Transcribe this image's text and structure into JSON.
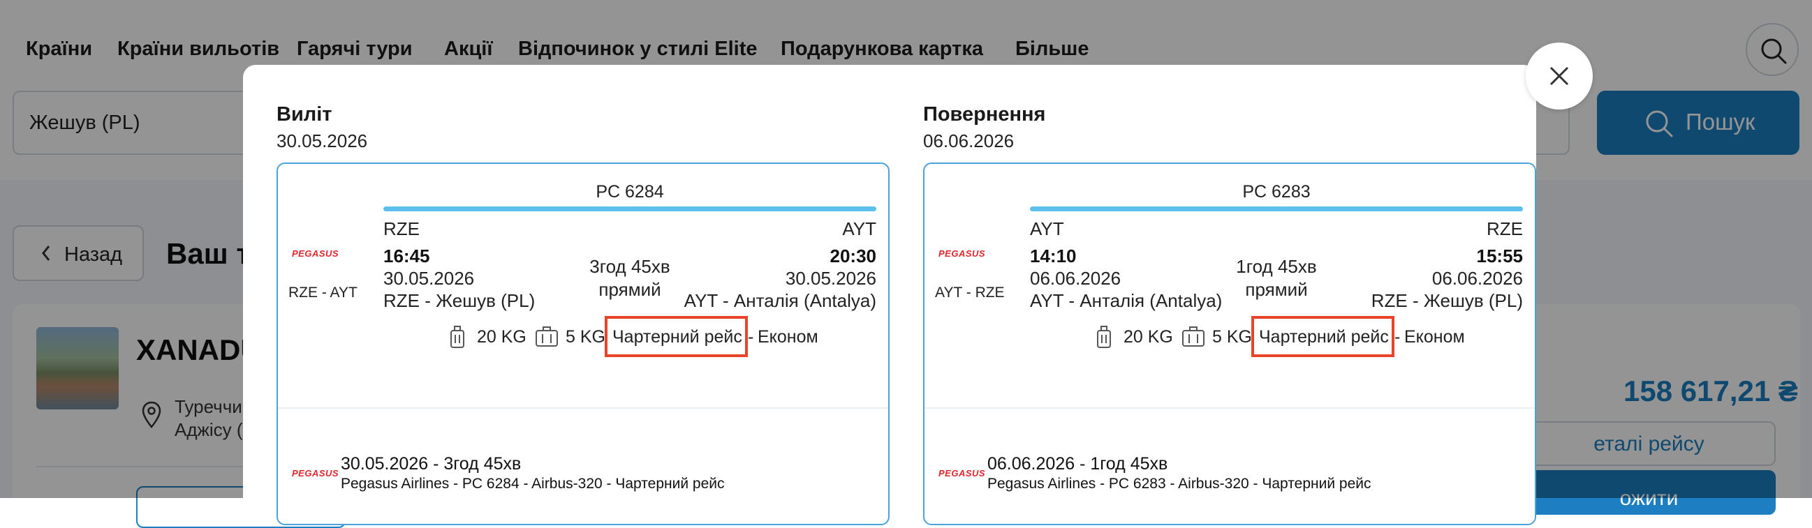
{
  "nav": {
    "items": [
      "Країни",
      "Країни вильотів",
      "Гарячі тури",
      "Акції",
      "Відпочинок у стилі Elite",
      "Подарункова картка",
      "Більше"
    ]
  },
  "search": {
    "origin_value": "Жешув (PL)",
    "button_label": "Пошук"
  },
  "page": {
    "back_label": "Назад",
    "title": "Ваш т",
    "hotel_name": "XANADU",
    "location_line1": "Туреччин",
    "location_line2": "Аджісу (А",
    "price": "158 617,21 ₴",
    "details_label": "еталі рейсу",
    "book_label": "ожити"
  },
  "colors": {
    "accent": "#1d7fc2",
    "route_bar": "#5bc0eb",
    "highlight": "#e8442a",
    "airline": "#e3262d"
  },
  "modal": {
    "departure": {
      "heading": "Виліт",
      "date": "30.05.2026",
      "airline_logo": "PEGASUS",
      "route_short": "RZE - AYT",
      "flight_number": "PC 6284",
      "from_code": "RZE",
      "to_code": "AYT",
      "dep_time": "16:45",
      "arr_time": "20:30",
      "dep_date": "30.05.2026",
      "arr_date": "30.05.2026",
      "duration": "3год 45хв",
      "stops": "прямий",
      "from_city": "RZE - Жешув (PL)",
      "to_city": "AYT - Анталія (Antalya)",
      "baggage": "20 KG",
      "hand_luggage": "5 KG",
      "flight_type": "Чартерний рейс",
      "sep": "-",
      "class": "Економ",
      "segment_date": "30.05.2026 - 3год 45хв",
      "segment_info": "Pegasus Airlines - PC 6284 - Airbus-320 - Чартерний рейс"
    },
    "return": {
      "heading": "Повернення",
      "date": "06.06.2026",
      "airline_logo": "PEGASUS",
      "route_short": "AYT - RZE",
      "flight_number": "PC 6283",
      "from_code": "AYT",
      "to_code": "RZE",
      "dep_time": "14:10",
      "arr_time": "15:55",
      "dep_date": "06.06.2026",
      "arr_date": "06.06.2026",
      "duration": "1год 45хв",
      "stops": "прямий",
      "from_city": "AYT - Анталія (Antalya)",
      "to_city": "RZE - Жешув (PL)",
      "baggage": "20 KG",
      "hand_luggage": "5 KG",
      "flight_type": "Чартерний рейс",
      "sep": "-",
      "class": "Економ",
      "segment_date": "06.06.2026 - 1год 45хв",
      "segment_info": "Pegasus Airlines - PC 6283 - Airbus-320 - Чартерний рейс"
    }
  }
}
